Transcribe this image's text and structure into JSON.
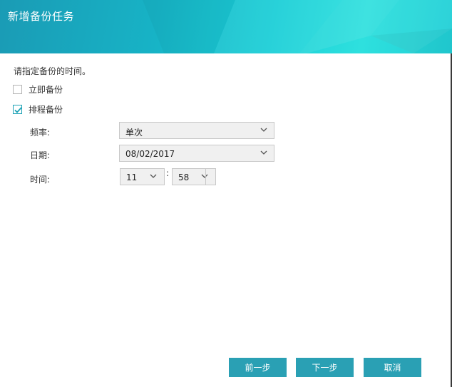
{
  "dialog": {
    "title": "新增备份任务",
    "prompt": "请指定备份的时间。"
  },
  "options": {
    "immediate": {
      "label": "立即备份",
      "checked": false
    },
    "scheduled": {
      "label": "排程备份",
      "checked": true
    }
  },
  "schedule": {
    "frequency_label": "频率:",
    "frequency_value": "单次",
    "date_label": "日期:",
    "date_value": "08/02/2017",
    "time_label": "时间:",
    "hour_value": "11",
    "time_separator": ":",
    "minute_value": "58"
  },
  "buttons": {
    "prev": "前一步",
    "next": "下一步",
    "cancel": "取消"
  },
  "colors": {
    "accent": "#2aa0b4",
    "header_start": "#1a9bb5",
    "header_end": "#2ee0de"
  }
}
